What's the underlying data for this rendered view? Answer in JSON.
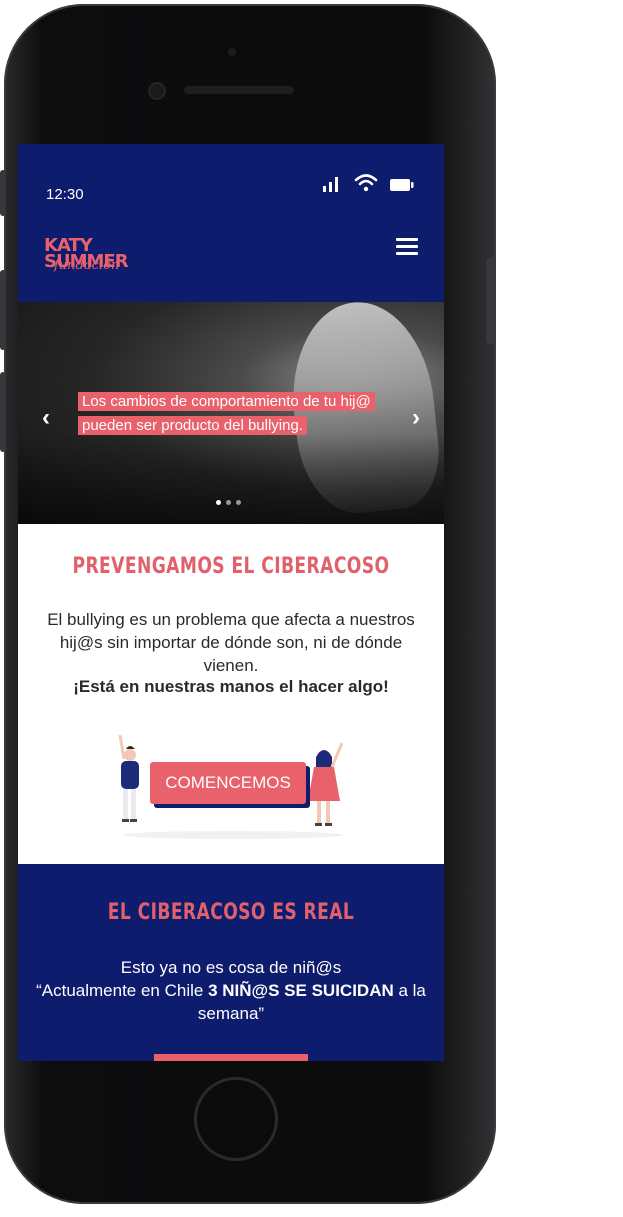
{
  "status_bar": {
    "time": "12:30"
  },
  "brand": {
    "line1": "KATY",
    "line2": "SUMMER",
    "script": "fundación",
    "color": "#e8616b",
    "nav_color": "#0e1c6e"
  },
  "hero": {
    "caption": "Los cambios de comportamiento de tu hij@ pueden ser producto del bullying.",
    "prev_icon": "chevron-left-icon",
    "next_icon": "chevron-right-icon",
    "slides_total": 3,
    "active_slide": 1
  },
  "section_prevent": {
    "title": "PREVENGAMOS EL CIBERACOSO",
    "text": "El bullying es un problema que afecta a nuestros hij@s sin importar de dónde son, ni de dónde vienen.",
    "emphasis": "¡Está en nuestras manos el hacer algo!",
    "cta_label": "COMENCEMOS"
  },
  "section_real": {
    "title": "EL CIBERACOSO ES REAL",
    "line1": "Esto ya no es cosa de niñ@s",
    "quote_start": "“Actualmente en Chile ",
    "quote_bold": "3 NIÑ@S SE SUICIDAN",
    "quote_end": " a la semana”"
  }
}
